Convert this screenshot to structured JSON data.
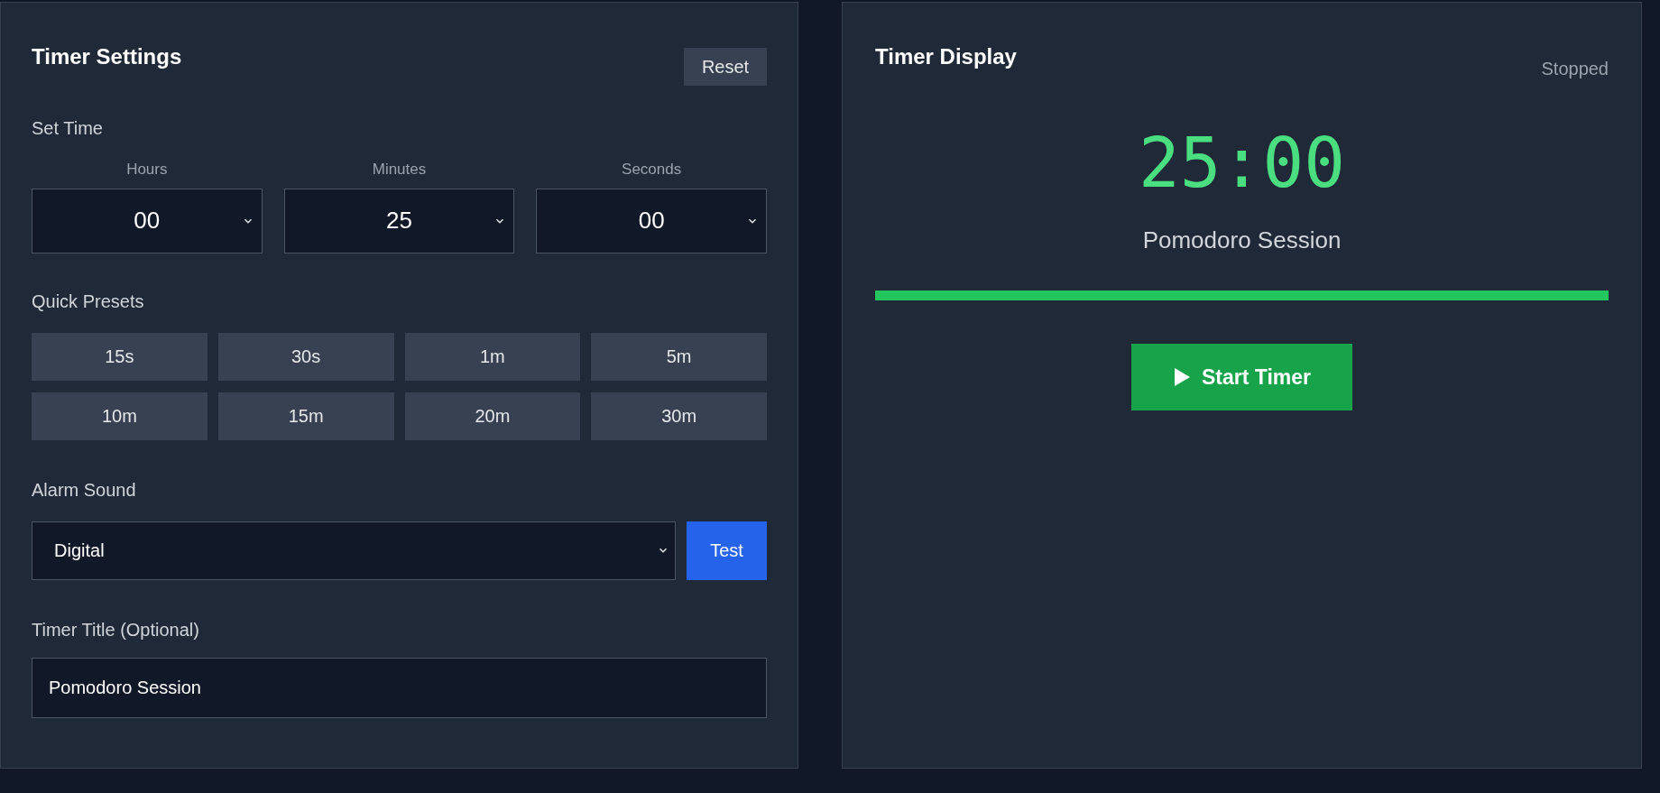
{
  "settings": {
    "title": "Timer Settings",
    "reset": "Reset",
    "set_time_label": "Set Time",
    "time_fields": [
      {
        "label": "Hours",
        "value": "00"
      },
      {
        "label": "Minutes",
        "value": "25"
      },
      {
        "label": "Seconds",
        "value": "00"
      }
    ],
    "presets_label": "Quick Presets",
    "presets": [
      "15s",
      "30s",
      "1m",
      "5m",
      "10m",
      "15m",
      "20m",
      "30m"
    ],
    "alarm_label": "Alarm Sound",
    "alarm_value": "Digital",
    "test": "Test",
    "title_label": "Timer Title (Optional)",
    "title_value": "Pomodoro Session"
  },
  "display": {
    "title": "Timer Display",
    "status": "Stopped",
    "time": "25:00",
    "session": "Pomodoro Session",
    "progress": {
      "level": 1
    },
    "start": "Start Timer"
  }
}
